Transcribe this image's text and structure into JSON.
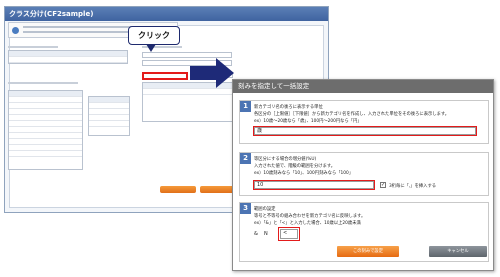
{
  "back_window": {
    "title": "クラス分け(CF2sample)"
  },
  "callout": {
    "label": "クリック"
  },
  "dialog": {
    "title": "刻みを指定して一括設定",
    "section1": {
      "number": "1",
      "line1": "新カテゴリ名の後ろに表示する単位",
      "line2": "各区分の［上限値］［下限値］から新カテゴリ名を作成し、入力された単位をその後ろに表示します。",
      "line3": "ex）10歳〜20歳なら「歳」、100円〜200円なら「円」",
      "value": "歳"
    },
    "section2": {
      "number": "2",
      "line1": "等区分にする場合の増分値(%U)",
      "line2": "入力された値で、階級の範囲を分けます。",
      "line3": "ex）10歳刻みなら「10」、100円刻みなら「100」",
      "value": "10",
      "checkbox_checked": "✓",
      "checkbox_label": "3桁毎に「,」を挿入する"
    },
    "section3": {
      "number": "3",
      "line1": "範囲の設定",
      "line2": "等号と不等号の組み合わせを新カテゴリ名に反映します。",
      "line3": "ex）「&」と「<」と入力した場合、10歳以上20歳未満",
      "label_amp": "&",
      "label_n": "N",
      "select_value": "<"
    },
    "ok_button": "この刻みで設定",
    "cancel_button": "キャンセル"
  }
}
